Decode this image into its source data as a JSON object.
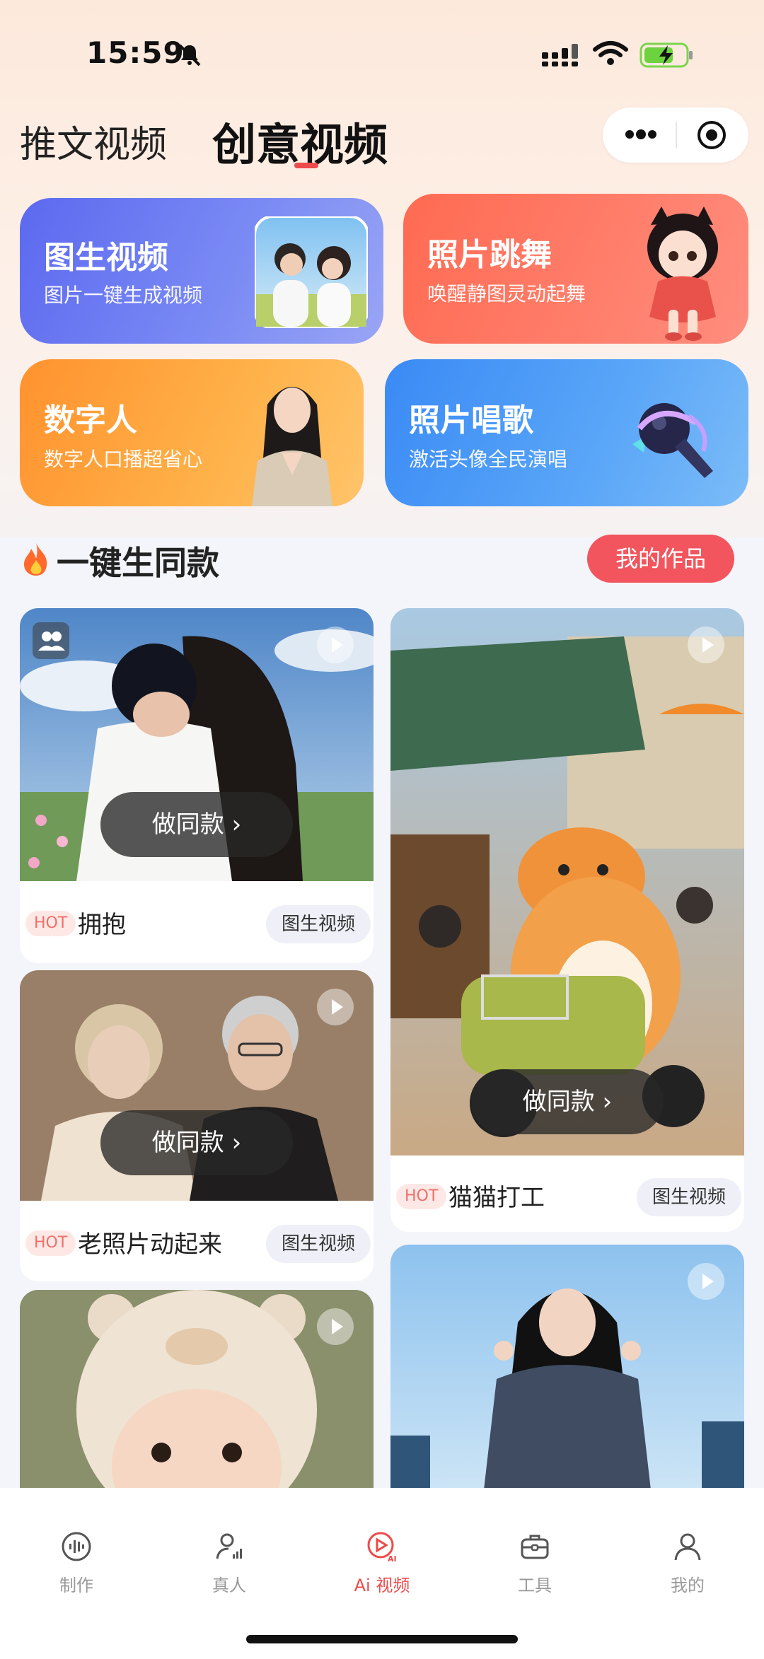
{
  "status_bar": {
    "time": "15:59"
  },
  "tabs": [
    {
      "label": "推文视频"
    },
    {
      "label": "创意视频"
    }
  ],
  "features": [
    {
      "title": "图生视频",
      "subtitle": "图片一键生成视频"
    },
    {
      "title": "照片跳舞",
      "subtitle": "唤醒静图灵动起舞"
    },
    {
      "title": "数字人",
      "subtitle": "数字人口播超省心"
    },
    {
      "title": "照片唱歌",
      "subtitle": "激活头像全民演唱"
    }
  ],
  "section": {
    "title": "一键生同款",
    "my_works": "我的作品"
  },
  "items": [
    {
      "title": "拥抱",
      "hot": "HOT",
      "tag": "图生视频",
      "button": "做同款 ›"
    },
    {
      "title": "老照片动起来",
      "hot": "HOT",
      "tag": "图生视频",
      "button": "做同款 ›"
    },
    {
      "title": "猫猫打工",
      "hot": "HOT",
      "tag": "图生视频",
      "button": "做同款 ›"
    }
  ],
  "nav": [
    {
      "label": "制作"
    },
    {
      "label": "真人"
    },
    {
      "label": "Ai 视频"
    },
    {
      "label": "工具"
    },
    {
      "label": "我的"
    }
  ],
  "colors": {
    "accent": "#ee4a4a",
    "primary_card": "#5c69f0"
  }
}
